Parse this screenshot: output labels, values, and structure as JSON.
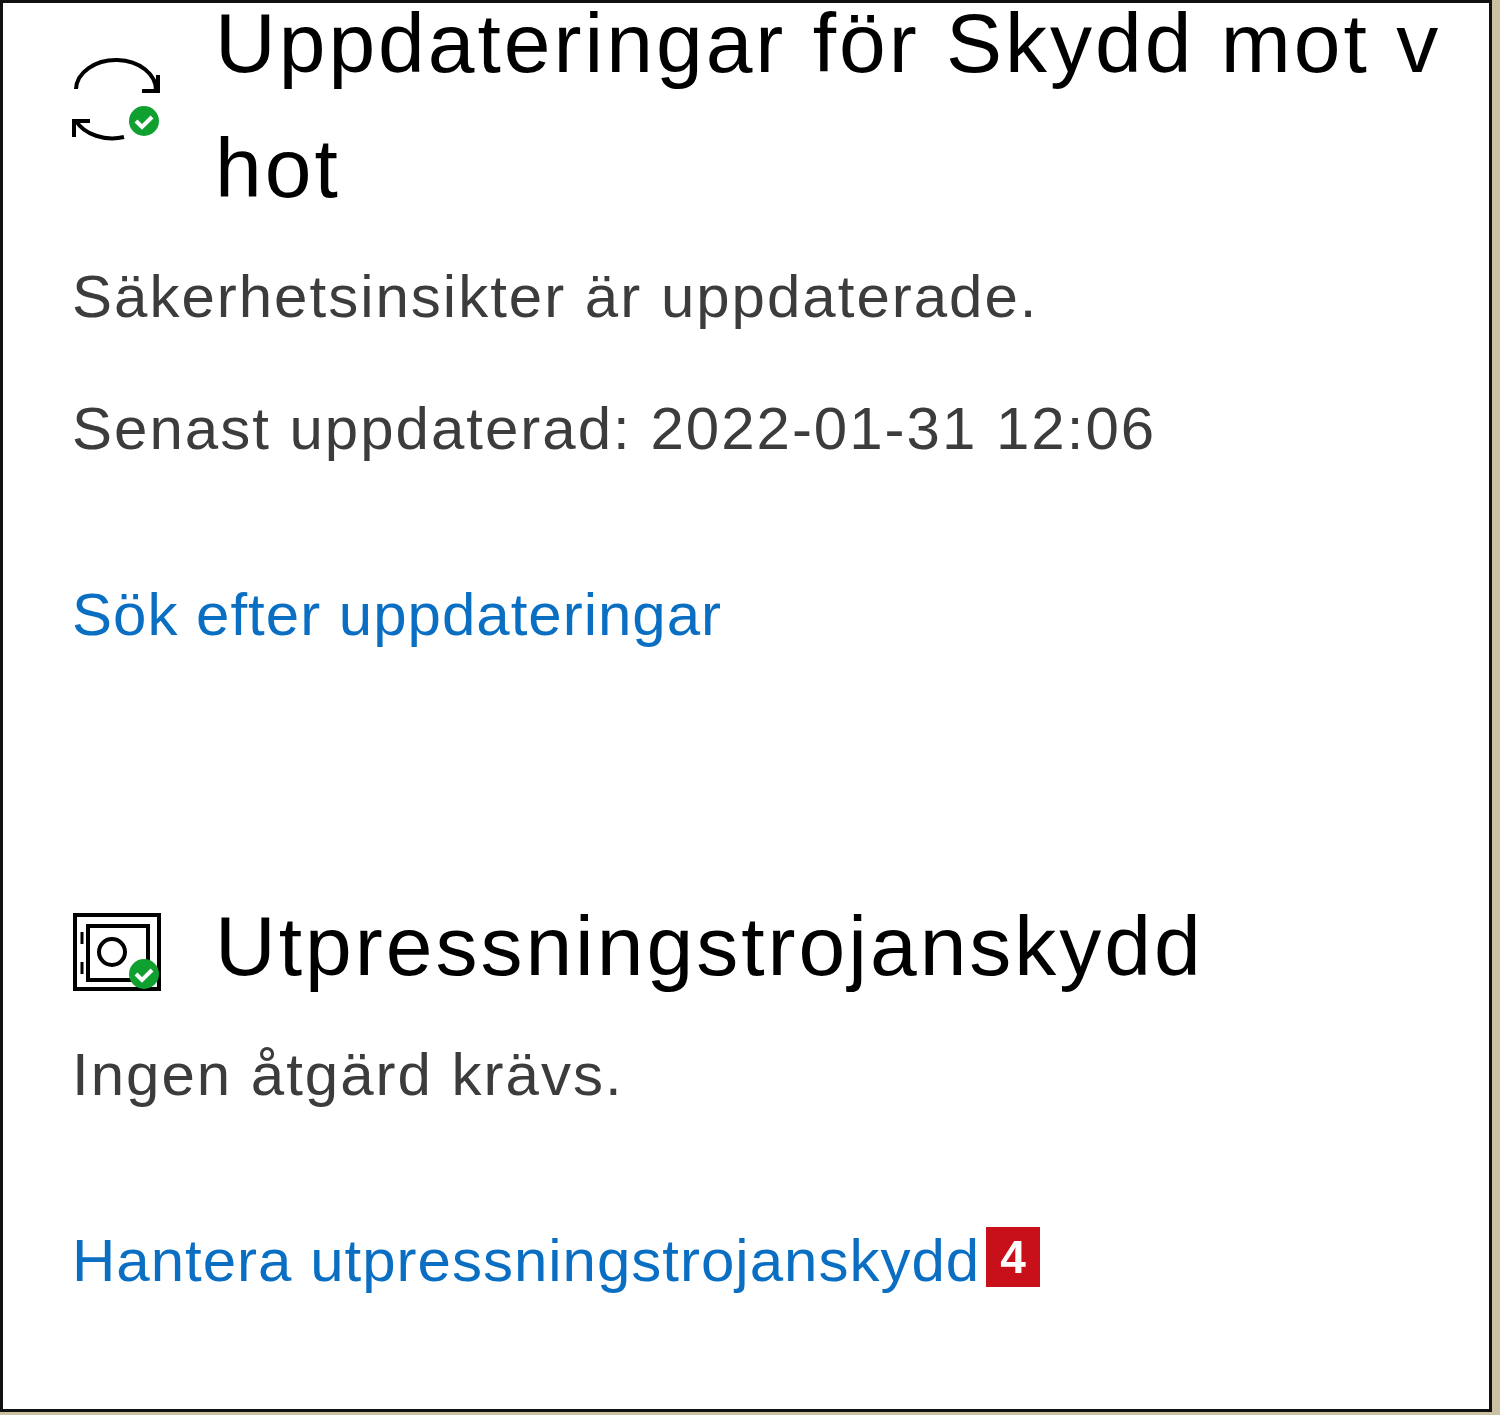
{
  "sections": [
    {
      "title_lines": [
        "Uppdateringar för Skydd mot v",
        "hot"
      ],
      "lines": [
        "Säkerhetsinsikter är uppdaterade.",
        "Senast uppdaterad: 2022-01-31 12:06"
      ],
      "link": "Sök efter uppdateringar"
    },
    {
      "title_lines": [
        "Utpressningstrojanskydd"
      ],
      "lines": [
        "Ingen åtgärd krävs."
      ],
      "link": "Hantera utpressningstrojanskydd",
      "badge": "4"
    }
  ]
}
